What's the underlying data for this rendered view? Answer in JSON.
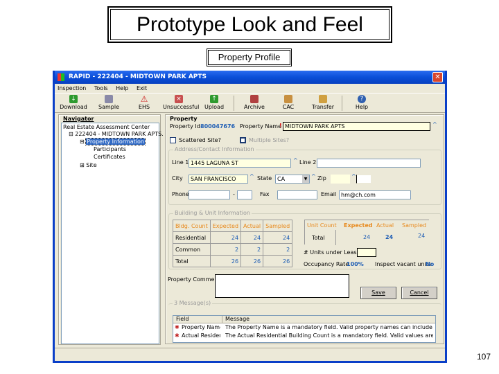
{
  "slide": {
    "title": "Prototype Look and Feel",
    "subtitle": "Property Profile",
    "page_number": "107"
  },
  "window": {
    "title": "RAPID - 222404 - MIDTOWN PARK APTS",
    "close_icon": "close-x-icon"
  },
  "menu": [
    "Inspection",
    "Tools",
    "Help",
    "Exit"
  ],
  "toolbar": [
    {
      "label": "Download",
      "icon": "download-arrow-icon",
      "color": "#2e9a2e"
    },
    {
      "label": "Sample",
      "icon": "sample-icon",
      "color": "#8a8aa8"
    },
    {
      "label": "EHS",
      "icon": "warning-icon",
      "color": "#cc2222"
    },
    {
      "label": "Unsuccessful",
      "icon": "unsuccessful-icon",
      "color": "#c85050"
    },
    {
      "label": "Upload",
      "icon": "upload-arrow-icon",
      "color": "#2e9a2e"
    },
    {
      "label": "Archive",
      "icon": "archive-icon",
      "color": "#b04040"
    },
    {
      "label": "CAC",
      "icon": "cac-icon",
      "color": "#c89040"
    },
    {
      "label": "Transfer",
      "icon": "transfer-icon",
      "color": "#d0a040"
    },
    {
      "label": "Help",
      "icon": "help-icon",
      "color": "#3060b0"
    }
  ],
  "navigator": {
    "title": "Navigator",
    "items": [
      "Real Estate Assessment Center",
      "222404 - MIDTOWN PARK APTS.",
      "Property Information",
      "Participants",
      "Certificates",
      "Site"
    ]
  },
  "property": {
    "title": "Property",
    "id_label": "Property Id",
    "id_value": "800047676",
    "name_label": "Property Name",
    "name_value": "MIDTOWN PARK APTS",
    "scattered_label": "Scattered Site?",
    "multiple_label": "Multiple Sites?"
  },
  "address": {
    "title": "Address/Contact Information",
    "line1_label": "Line 1",
    "line1_value": "1445 LAGUNA ST",
    "line2_label": "Line 2",
    "line2_value": "",
    "city_label": "City",
    "city_value": "SAN FRANCISCO",
    "state_label": "State",
    "state_value": "CA",
    "zip_label": "Zip",
    "zip_value": "",
    "phone_label": "Phone",
    "fax_label": "Fax",
    "email_label": "Email",
    "email_value": "hm@ch.com"
  },
  "building": {
    "title": "Building & Unit Information",
    "bldg_headers": [
      "Bldg. Count",
      "Expected",
      "Actual",
      "Sampled"
    ],
    "bldg_rows": [
      [
        "Residential",
        "24",
        "24",
        "24"
      ],
      [
        "Common",
        "2",
        "2",
        "2"
      ],
      [
        "Total",
        "26",
        "26",
        "26"
      ]
    ],
    "unit_headers": [
      "Unit Count",
      "Expected",
      "Actual",
      "Sampled"
    ],
    "unit_rows": [
      [
        "Total",
        "24",
        "24",
        "24"
      ]
    ],
    "lease_label": "# Units under Lease",
    "occupancy_label": "Occupancy Rate",
    "occupancy_value": "100%",
    "vacant_label": "Inspect vacant units",
    "vacant_value": "No"
  },
  "comments_label": "Property Comments",
  "buttons": {
    "save": "Save",
    "cancel": "Cancel"
  },
  "messages": {
    "title": "3 Message(s)",
    "headers": [
      "Field",
      "Message"
    ],
    "rows": [
      [
        "Property Name",
        "The Property Name is a mandatory field. Valid property names can include alphanumer..."
      ],
      [
        "Actual Resident...",
        "The Actual Residential Building Count is a mandatory field. Valid values are nonzero i..."
      ]
    ]
  },
  "colors": {
    "titlebar": "#0a4fd8",
    "accent_blue": "#1c5cb4",
    "header_orange": "#e8891c",
    "required_bg": "#ffffe1"
  }
}
